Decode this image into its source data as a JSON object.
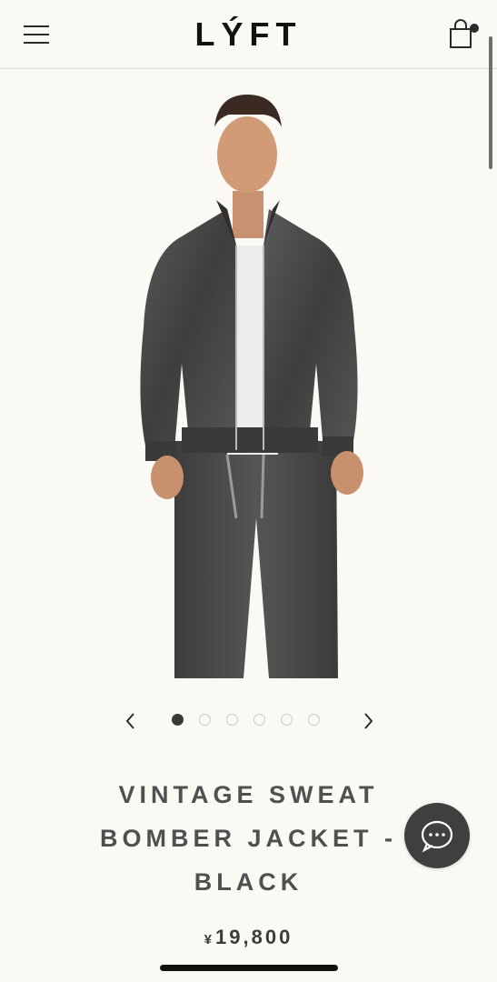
{
  "header": {
    "logo_text": "LÝFT",
    "menu_icon": "hamburger-icon",
    "cart_icon": "shopping-bag-icon"
  },
  "gallery": {
    "image_count": 6,
    "active_index": 0,
    "prev_icon": "chevron-left-icon",
    "next_icon": "chevron-right-icon"
  },
  "product": {
    "title_lines": [
      "VINTAGE SWEAT",
      "BOMBER JACKET -",
      "BLACK"
    ],
    "currency_symbol": "¥",
    "price": "19,800"
  },
  "chat": {
    "icon": "chat-bubble-icon"
  },
  "colors": {
    "background": "#faf9f4",
    "text": "#505050",
    "chat_button": "#3f3f3f",
    "jacket": "#4a4a4a"
  }
}
